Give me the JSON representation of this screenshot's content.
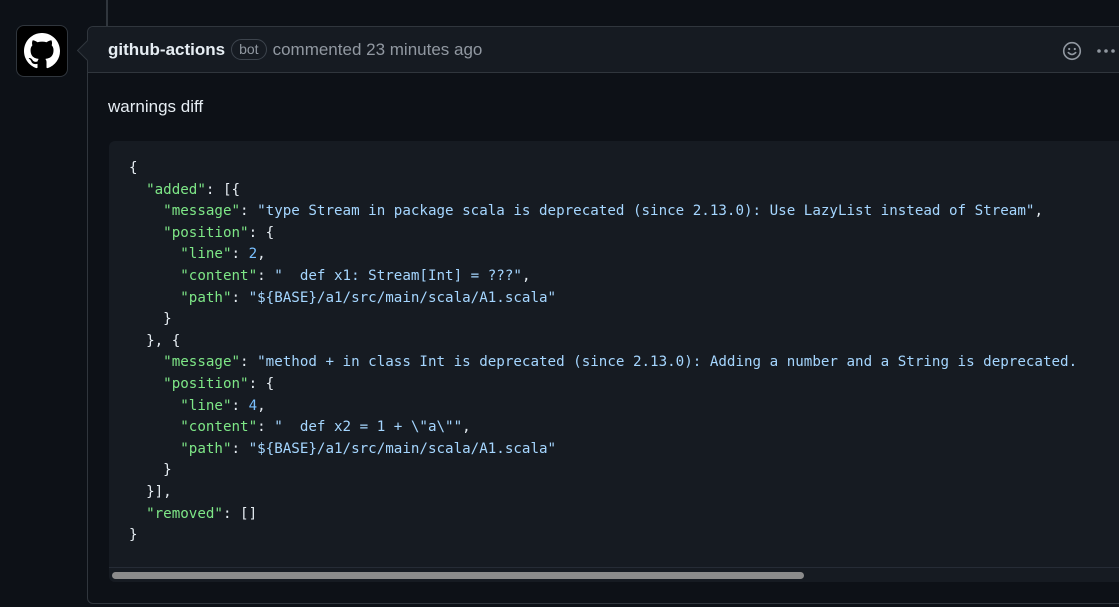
{
  "comment": {
    "author": "github-actions",
    "badge": "bot",
    "meta": "commented 23 minutes ago",
    "body_text": "warnings diff",
    "actions": {
      "reaction_icon": "smiley-icon",
      "more_icon": "kebab-horizontal-icon"
    },
    "avatar_icon": "github-mark-icon"
  },
  "code_lines": [
    [
      [
        "p",
        "{"
      ]
    ],
    [
      [
        "p",
        "  "
      ],
      [
        "k",
        "\"added\""
      ],
      [
        "p",
        ": [{"
      ]
    ],
    [
      [
        "p",
        "    "
      ],
      [
        "k",
        "\"message\""
      ],
      [
        "p",
        ": "
      ],
      [
        "s",
        "\"type Stream in package scala is deprecated (since 2.13.0): Use LazyList instead of Stream\""
      ],
      [
        "p",
        ","
      ]
    ],
    [
      [
        "p",
        "    "
      ],
      [
        "k",
        "\"position\""
      ],
      [
        "p",
        ": {"
      ]
    ],
    [
      [
        "p",
        "      "
      ],
      [
        "k",
        "\"line\""
      ],
      [
        "p",
        ": "
      ],
      [
        "n",
        "2"
      ],
      [
        "p",
        ","
      ]
    ],
    [
      [
        "p",
        "      "
      ],
      [
        "k",
        "\"content\""
      ],
      [
        "p",
        ": "
      ],
      [
        "s",
        "\"  def x1: Stream[Int] = ???\""
      ],
      [
        "p",
        ","
      ]
    ],
    [
      [
        "p",
        "      "
      ],
      [
        "k",
        "\"path\""
      ],
      [
        "p",
        ": "
      ],
      [
        "s",
        "\"${BASE}/a1/src/main/scala/A1.scala\""
      ]
    ],
    [
      [
        "p",
        "    }"
      ]
    ],
    [
      [
        "p",
        "  }, {"
      ]
    ],
    [
      [
        "p",
        "    "
      ],
      [
        "k",
        "\"message\""
      ],
      [
        "p",
        ": "
      ],
      [
        "s",
        "\"method + in class Int is deprecated (since 2.13.0): Adding a number and a String is deprecated."
      ]
    ],
    [
      [
        "p",
        "    "
      ],
      [
        "k",
        "\"position\""
      ],
      [
        "p",
        ": {"
      ]
    ],
    [
      [
        "p",
        "      "
      ],
      [
        "k",
        "\"line\""
      ],
      [
        "p",
        ": "
      ],
      [
        "n",
        "4"
      ],
      [
        "p",
        ","
      ]
    ],
    [
      [
        "p",
        "      "
      ],
      [
        "k",
        "\"content\""
      ],
      [
        "p",
        ": "
      ],
      [
        "s",
        "\"  def x2 = 1 + \\\"a\\\"\""
      ],
      [
        "p",
        ","
      ]
    ],
    [
      [
        "p",
        "      "
      ],
      [
        "k",
        "\"path\""
      ],
      [
        "p",
        ": "
      ],
      [
        "s",
        "\"${BASE}/a1/src/main/scala/A1.scala\""
      ]
    ],
    [
      [
        "p",
        "    }"
      ]
    ],
    [
      [
        "p",
        "  }],"
      ]
    ],
    [
      [
        "p",
        "  "
      ],
      [
        "k",
        "\"removed\""
      ],
      [
        "p",
        ": []"
      ]
    ],
    [
      [
        "p",
        "}"
      ]
    ]
  ],
  "colors": {
    "background": "#0d1117",
    "header": "#161b22",
    "border": "#30363d",
    "key": "#7ee787",
    "string": "#a5d6ff",
    "number": "#79c0ff"
  }
}
